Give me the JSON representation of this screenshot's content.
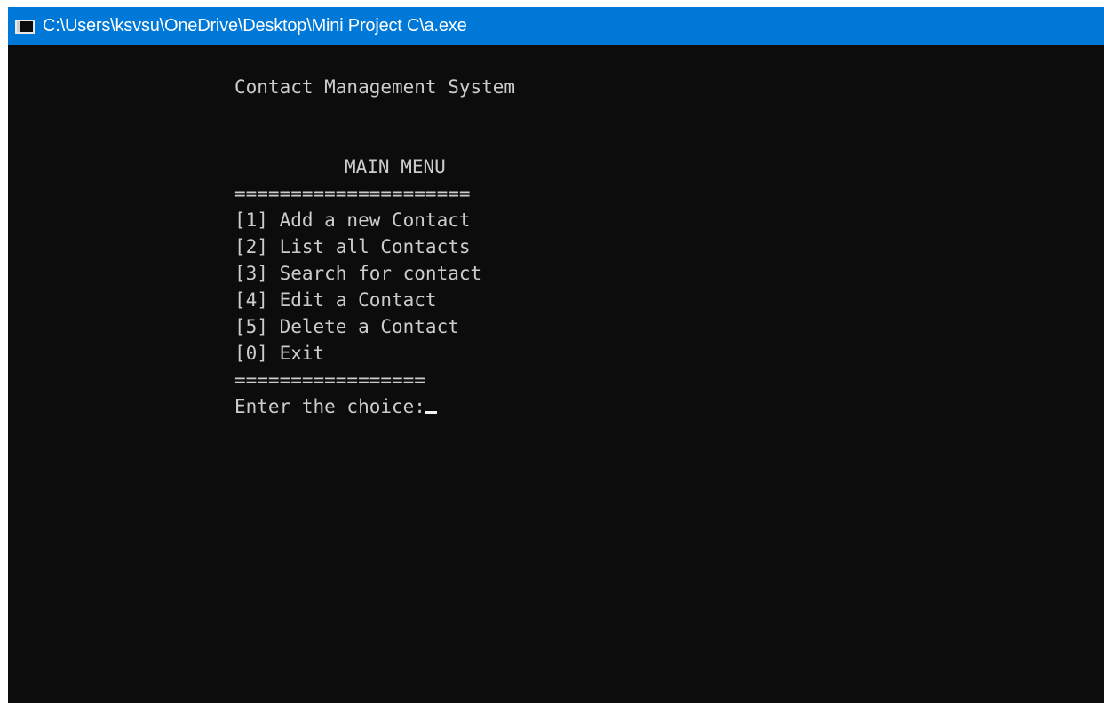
{
  "window": {
    "title": "C:\\Users\\ksvsu\\OneDrive\\Desktop\\Mini Project C\\a.exe",
    "icon": "console-window-icon"
  },
  "console": {
    "heading": "Contact Management System",
    "menu_title": "MAIN MENU",
    "separator_top": "=====================",
    "options": [
      "[1] Add a new Contact",
      "[2] List all Contacts",
      "[3] Search for contact",
      "[4] Edit a Contact",
      "[5] Delete a Contact",
      "[0] Exit"
    ],
    "separator_bottom": "=================",
    "prompt": "Enter the choice:"
  },
  "colors": {
    "titlebar": "#0078d7",
    "console_background": "#0c0c0c",
    "console_text": "#cccccc"
  }
}
